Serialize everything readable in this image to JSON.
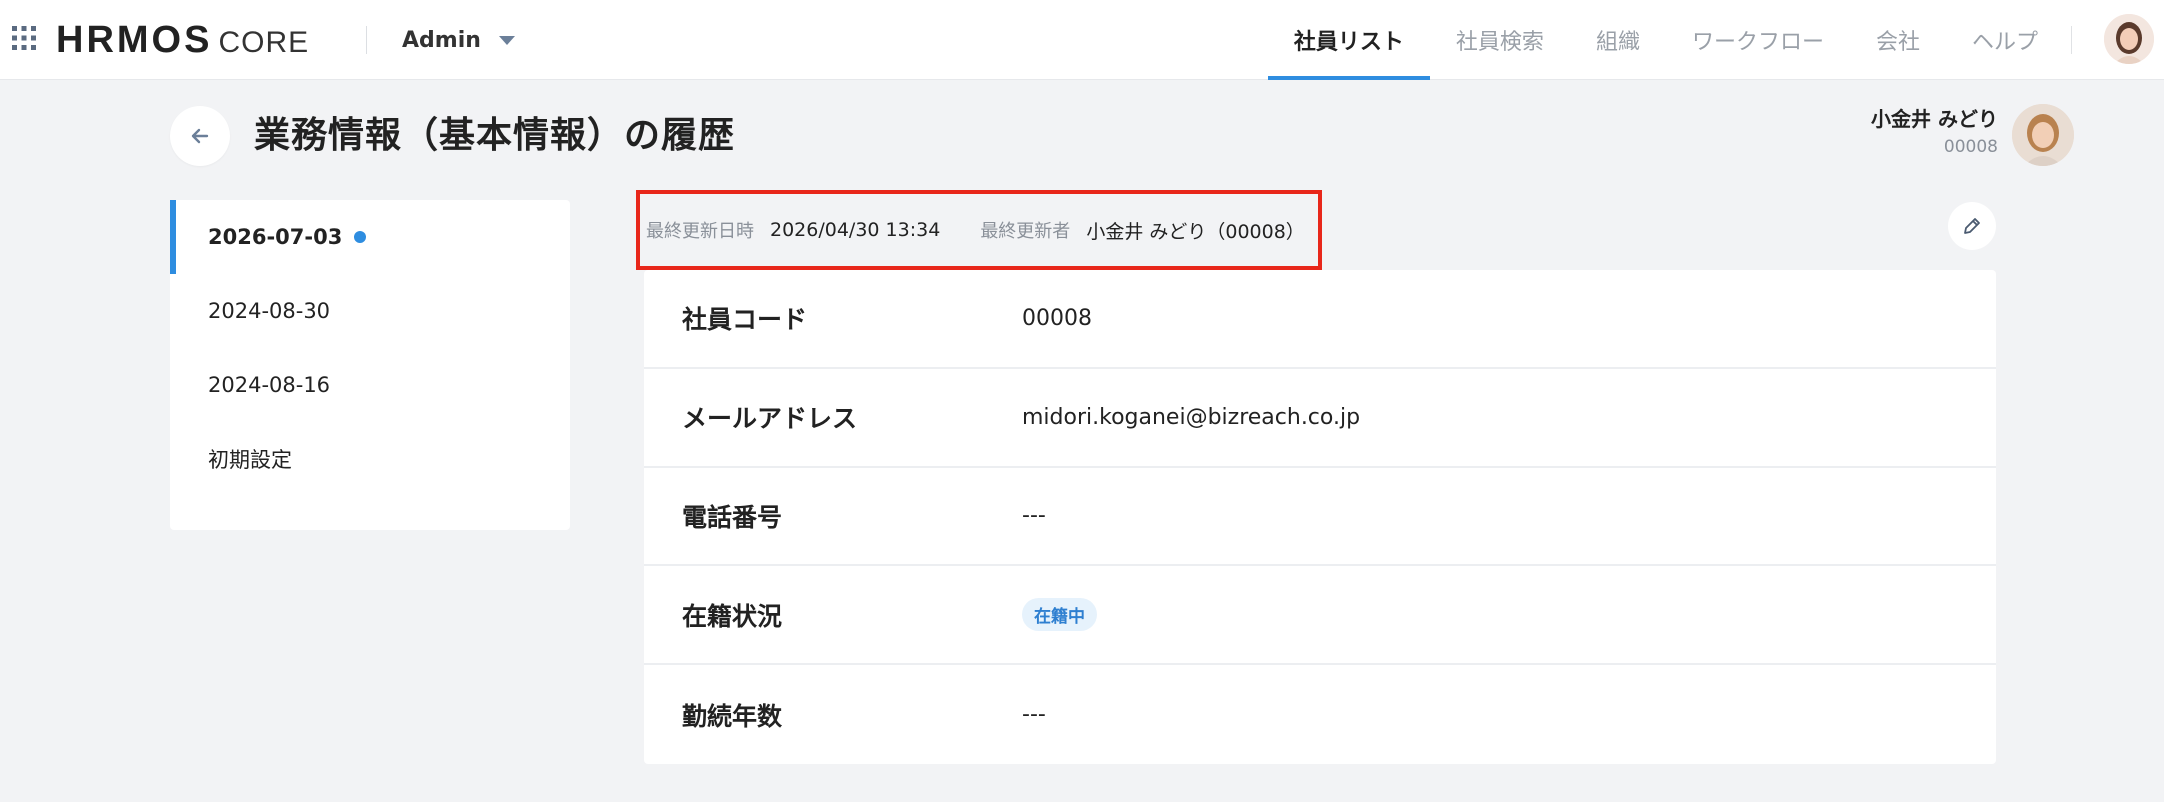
{
  "header": {
    "logo_main": "HRMOS",
    "logo_sub": "CORE",
    "role": "Admin",
    "nav": [
      {
        "label": "社員リスト",
        "active": true
      },
      {
        "label": "社員検索",
        "active": false
      },
      {
        "label": "組織",
        "active": false
      },
      {
        "label": "ワークフロー",
        "active": false
      },
      {
        "label": "会社",
        "active": false
      },
      {
        "label": "ヘルプ",
        "active": false
      }
    ]
  },
  "page": {
    "title": "業務情報（基本情報）の履歴",
    "user_name": "小金井 みどり",
    "user_code": "00008"
  },
  "history": {
    "items": [
      {
        "label": "2026-07-03",
        "active": true
      },
      {
        "label": "2024-08-30",
        "active": false
      },
      {
        "label": "2024-08-16",
        "active": false
      },
      {
        "label": "初期設定",
        "active": false
      }
    ]
  },
  "meta": {
    "updated_at_label": "最終更新日時",
    "updated_at": "2026/04/30 13:34",
    "updated_by_label": "最終更新者",
    "updated_by": "小金井 みどり（00008）"
  },
  "info": {
    "rows": [
      {
        "label": "社員コード",
        "value": "00008"
      },
      {
        "label": "メールアドレス",
        "value": "midori.koganei@bizreach.co.jp"
      },
      {
        "label": "電話番号",
        "value": "---"
      },
      {
        "label": "在籍状況",
        "value": "在籍中"
      },
      {
        "label": "勤続年数",
        "value": "---"
      }
    ]
  },
  "colors": {
    "accent": "#2e8de0",
    "highlight_border": "#e8261a",
    "background": "#f2f3f5"
  },
  "icons": [
    "apps-grid-icon",
    "chevron-down-icon",
    "arrow-left-icon",
    "pencil-icon"
  ]
}
